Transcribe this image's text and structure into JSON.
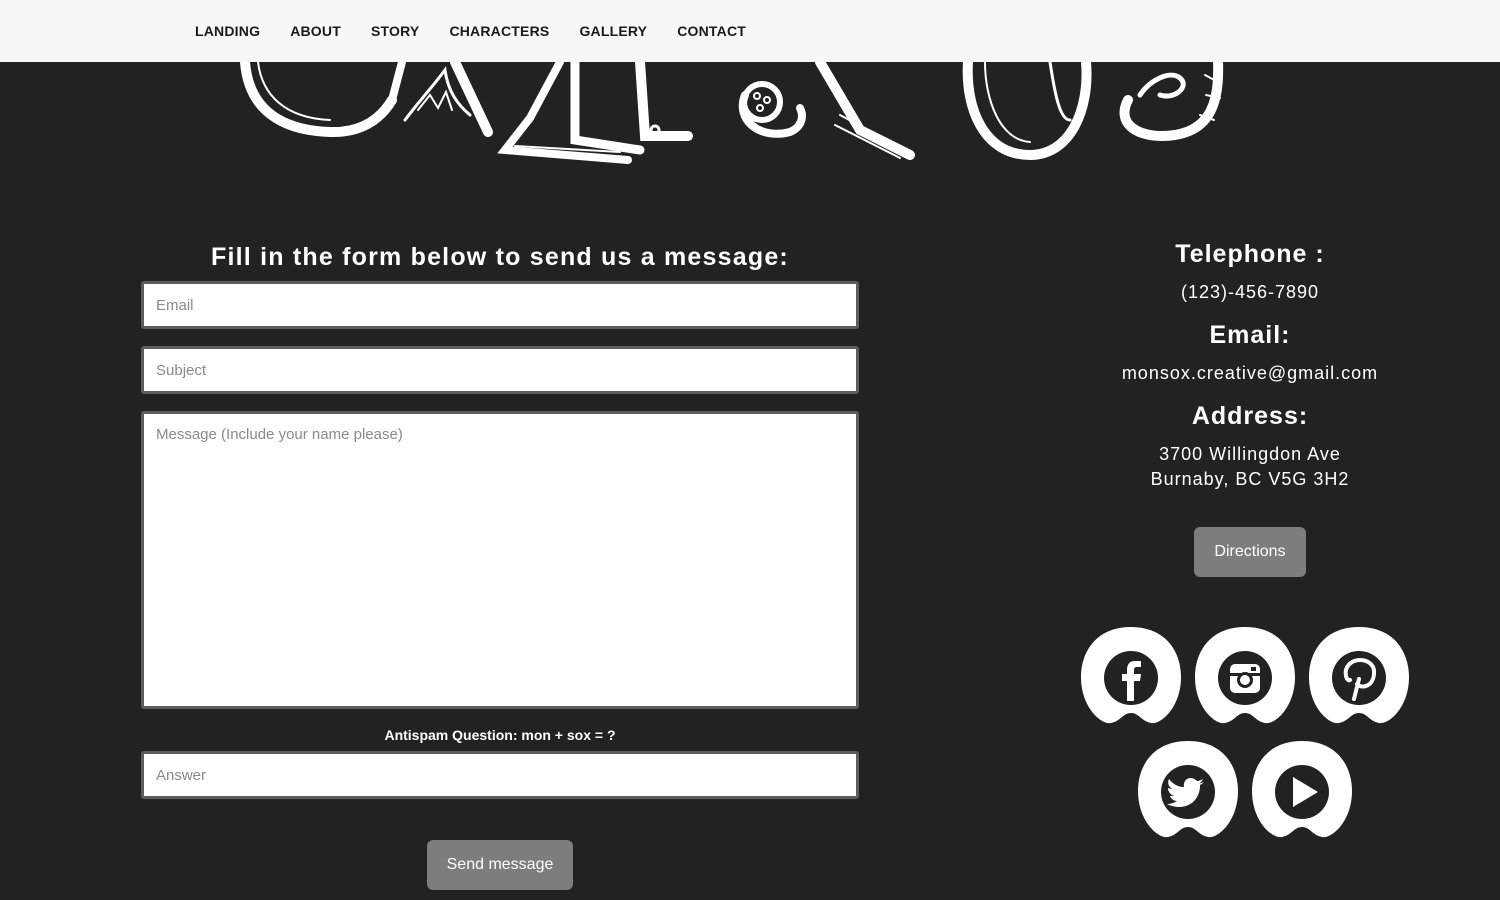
{
  "nav": {
    "items": [
      "LANDING",
      "ABOUT",
      "STORY",
      "CHARACTERS",
      "GALLERY",
      "CONTACT"
    ]
  },
  "form": {
    "title": "Fill in the form below to send us a message:",
    "email_placeholder": "Email",
    "subject_placeholder": "Subject",
    "message_placeholder": "Message (Include your name please)",
    "antispam_label": "Antispam Question: mon + sox = ?",
    "answer_placeholder": "Answer",
    "send_label": "Send message"
  },
  "contact_info": {
    "telephone_heading": "Telephone :",
    "telephone_value": "(123)-456-7890",
    "email_heading": "Email:",
    "email_value": "monsox.creative@gmail.com",
    "address_heading": "Address:",
    "address_line1": "3700 Willingdon Ave",
    "address_line2": "Burnaby, BC V5G 3H2",
    "directions_label": "Directions"
  },
  "social": [
    "facebook-icon",
    "instagram-icon",
    "pinterest-icon",
    "twitter-icon",
    "youtube-icon"
  ],
  "colors": {
    "background": "#222222",
    "nav_bg": "#f7f7f7",
    "button_bg": "#7d7d7d",
    "text": "#ffffff"
  }
}
